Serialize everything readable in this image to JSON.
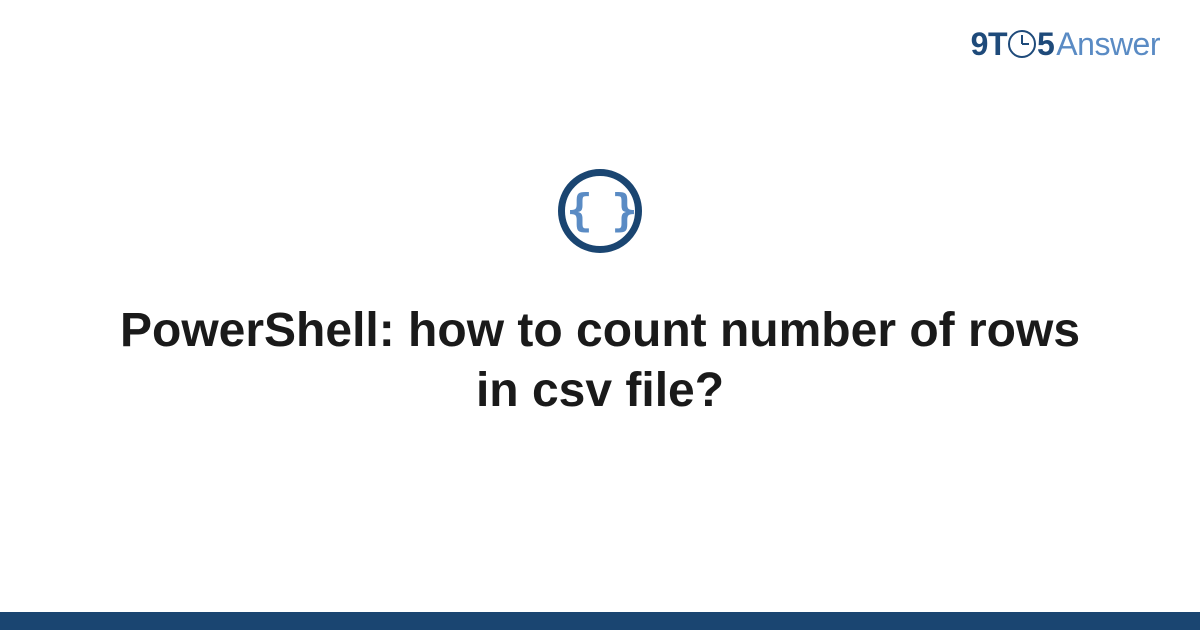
{
  "brand": {
    "part1": "9T",
    "part2": "5",
    "part3": "Answer"
  },
  "icon": {
    "glyph": "{ }",
    "name": "code-braces-icon"
  },
  "title": "PowerShell: how to count number of rows in csv file?",
  "colors": {
    "brand_dark": "#1e4a7a",
    "brand_light": "#5a8bc4",
    "icon_ring": "#1a4571",
    "footer": "#1a4571",
    "text": "#1a1a1a"
  }
}
